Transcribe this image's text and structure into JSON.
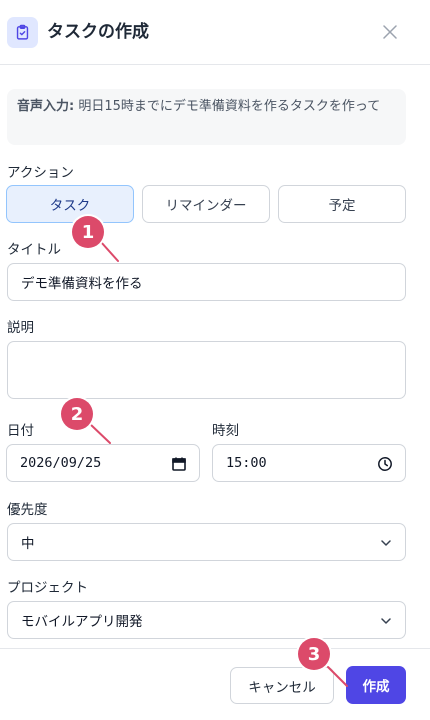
{
  "header": {
    "title": "タスクの作成",
    "icon": "clipboard-check-icon",
    "close_icon": "close-icon"
  },
  "voice_input": {
    "prefix": "音声入力:",
    "text": " 明日15時までにデモ準備資料を作るタスクを作って"
  },
  "action": {
    "label": "アクション",
    "options": [
      "タスク",
      "リマインダー",
      "予定"
    ],
    "selected": "タスク"
  },
  "title_field": {
    "label": "タイトル",
    "value": "デモ準備資料を作る"
  },
  "description_field": {
    "label": "説明",
    "value": ""
  },
  "date_field": {
    "label": "日付",
    "value": "2026/09/25",
    "icon": "calendar-icon"
  },
  "time_field": {
    "label": "時刻",
    "value": "15:00",
    "icon": "clock-icon"
  },
  "priority_field": {
    "label": "優先度",
    "value": "中",
    "icon": "chevron-down-icon"
  },
  "project_field": {
    "label": "プロジェクト",
    "value": "モバイルアプリ開発",
    "icon": "chevron-down-icon"
  },
  "footer": {
    "cancel_label": "キャンセル",
    "create_label": "作成"
  },
  "annotations": {
    "marker1": "1",
    "marker2": "2",
    "marker3": "3"
  },
  "colors": {
    "accent": "#4f46e5",
    "marker": "#dc4a6a",
    "active_segment_bg": "#e8f0fd"
  }
}
